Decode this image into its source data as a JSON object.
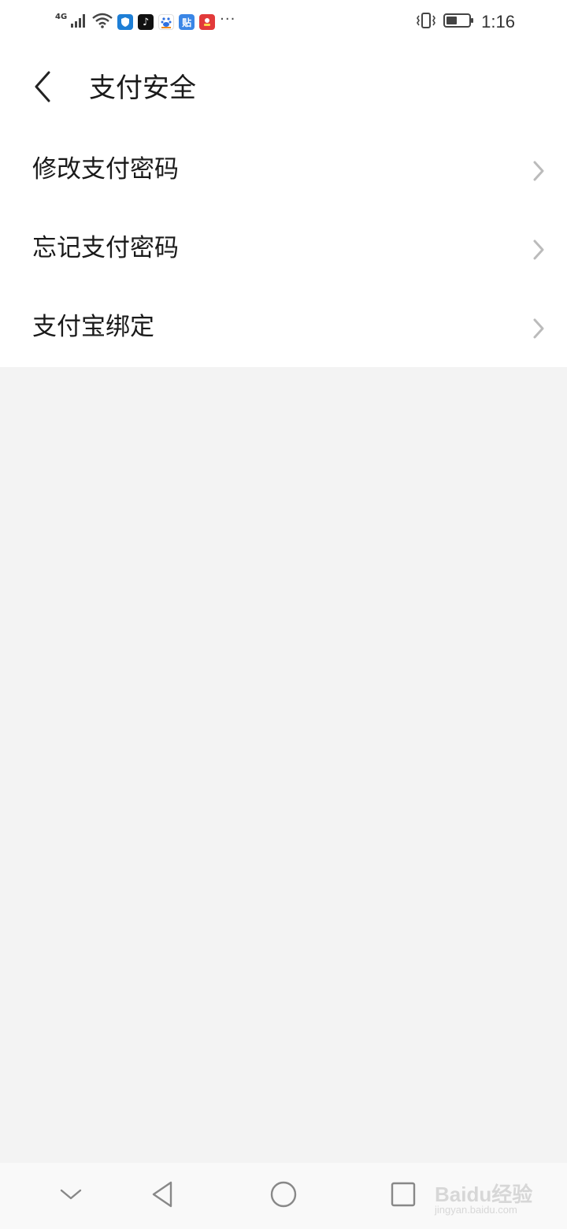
{
  "status_bar": {
    "network": "4G",
    "time": "1:16",
    "more": "···",
    "icons": [
      "signal-icon",
      "wifi-icon",
      "shield-app-icon",
      "tiktok-app-icon",
      "baidu-app-icon",
      "tieba-app-icon",
      "game-app-icon",
      "vibrate-icon",
      "battery-icon"
    ],
    "app_icon_labels": {
      "tiktok": "♪",
      "tieba": "贴"
    },
    "battery_level": 0.45
  },
  "header": {
    "title": "支付安全",
    "back_icon": "chevron-left-icon"
  },
  "menu": {
    "items": [
      {
        "label": "修改支付密码",
        "icon": "chevron-right-icon"
      },
      {
        "label": "忘记支付密码",
        "icon": "chevron-right-icon"
      },
      {
        "label": "支付宝绑定",
        "icon": "chevron-right-icon"
      }
    ]
  },
  "nav_bar": {
    "icons": [
      "chevron-down-icon",
      "back-triangle-icon",
      "home-circle-icon",
      "recents-square-icon"
    ]
  },
  "watermark": {
    "main": "Baidu经验",
    "sub": "jingyan.baidu.com"
  },
  "colors": {
    "background": "#f3f3f3",
    "surface": "#ffffff",
    "text": "#1a1a1a",
    "chevron": "#bbbbbb"
  }
}
